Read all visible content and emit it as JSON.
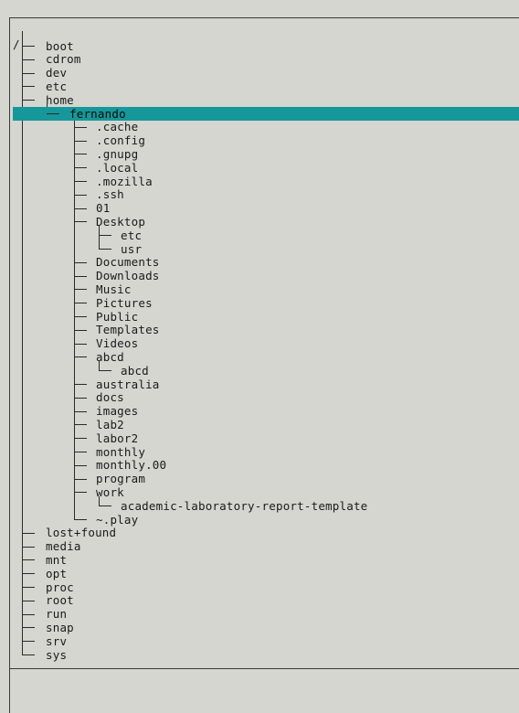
{
  "tree": {
    "root": "/",
    "nodes": [
      {
        "label": "boot",
        "depth": 0,
        "last": false
      },
      {
        "label": "cdrom",
        "depth": 0,
        "last": false
      },
      {
        "label": "dev",
        "depth": 0,
        "last": false
      },
      {
        "label": "etc",
        "depth": 0,
        "last": false
      },
      {
        "label": "home",
        "depth": 0,
        "last": false
      },
      {
        "label": "fernando",
        "depth": 1,
        "last": true,
        "selected": true
      },
      {
        "label": ".cache",
        "depth": 2,
        "last": false
      },
      {
        "label": ".config",
        "depth": 2,
        "last": false
      },
      {
        "label": ".gnupg",
        "depth": 2,
        "last": false
      },
      {
        "label": ".local",
        "depth": 2,
        "last": false
      },
      {
        "label": ".mozilla",
        "depth": 2,
        "last": false
      },
      {
        "label": ".ssh",
        "depth": 2,
        "last": false
      },
      {
        "label": "01",
        "depth": 2,
        "last": false
      },
      {
        "label": "Desktop",
        "depth": 2,
        "last": false
      },
      {
        "label": "etc",
        "depth": 3,
        "last": false
      },
      {
        "label": "usr",
        "depth": 3,
        "last": true
      },
      {
        "label": "Documents",
        "depth": 2,
        "last": false
      },
      {
        "label": "Downloads",
        "depth": 2,
        "last": false
      },
      {
        "label": "Music",
        "depth": 2,
        "last": false
      },
      {
        "label": "Pictures",
        "depth": 2,
        "last": false
      },
      {
        "label": "Public",
        "depth": 2,
        "last": false
      },
      {
        "label": "Templates",
        "depth": 2,
        "last": false
      },
      {
        "label": "Videos",
        "depth": 2,
        "last": false
      },
      {
        "label": "abcd",
        "depth": 2,
        "last": false
      },
      {
        "label": "abcd",
        "depth": 3,
        "last": true
      },
      {
        "label": "australia",
        "depth": 2,
        "last": false
      },
      {
        "label": "docs",
        "depth": 2,
        "last": false
      },
      {
        "label": "images",
        "depth": 2,
        "last": false
      },
      {
        "label": "lab2",
        "depth": 2,
        "last": false
      },
      {
        "label": "labor2",
        "depth": 2,
        "last": false
      },
      {
        "label": "monthly",
        "depth": 2,
        "last": false
      },
      {
        "label": "monthly.00",
        "depth": 2,
        "last": false
      },
      {
        "label": "program",
        "depth": 2,
        "last": false
      },
      {
        "label": "work",
        "depth": 2,
        "last": false
      },
      {
        "label": "academic-laboratory-report-template",
        "depth": 3,
        "last": true
      },
      {
        "label": "~.play",
        "depth": 2,
        "last": true
      },
      {
        "label": "lost+found",
        "depth": 0,
        "last": false
      },
      {
        "label": "media",
        "depth": 0,
        "last": false
      },
      {
        "label": "mnt",
        "depth": 0,
        "last": false
      },
      {
        "label": "opt",
        "depth": 0,
        "last": false
      },
      {
        "label": "proc",
        "depth": 0,
        "last": false
      },
      {
        "label": "root",
        "depth": 0,
        "last": false
      },
      {
        "label": "run",
        "depth": 0,
        "last": false
      },
      {
        "label": "snap",
        "depth": 0,
        "last": false
      },
      {
        "label": "srv",
        "depth": 0,
        "last": false
      },
      {
        "label": "sys",
        "depth": 0,
        "last": false
      }
    ]
  },
  "colors": {
    "background": "#d5d6d0",
    "selection": "#16989a",
    "text": "#1a1a1a"
  }
}
